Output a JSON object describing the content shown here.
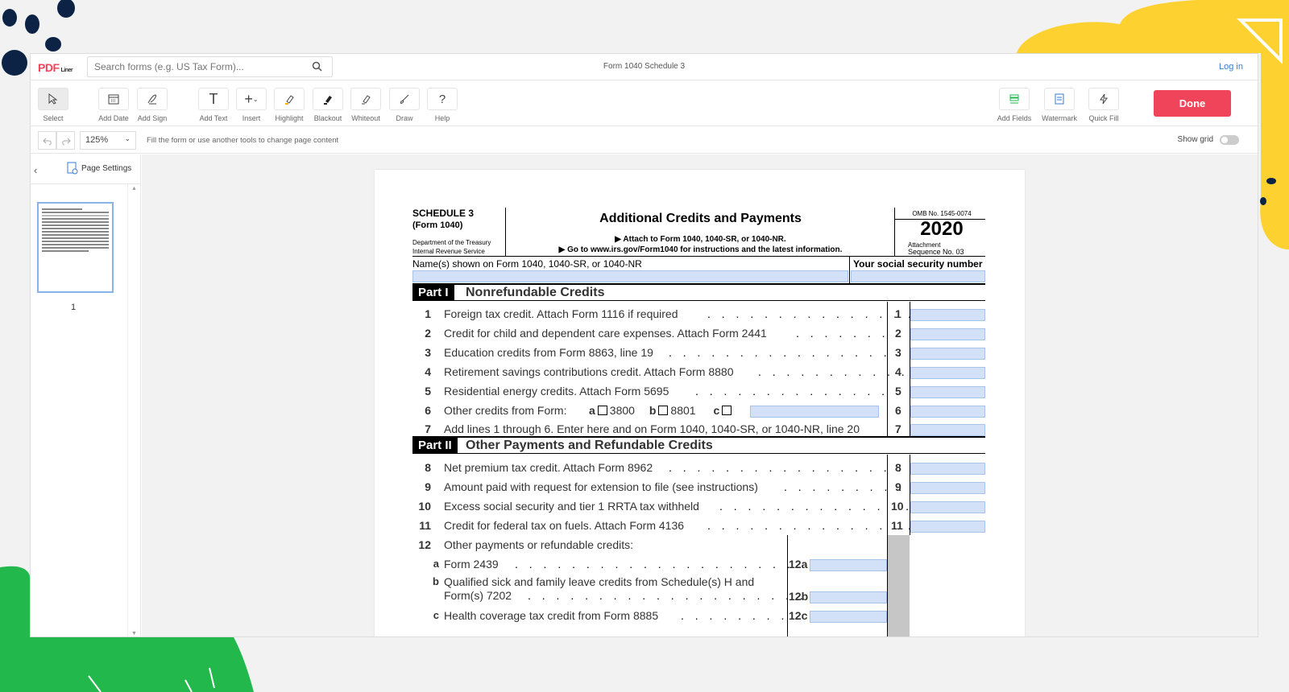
{
  "app": {
    "logo": "PDF",
    "logo_sub": "Liner",
    "search_placeholder": "Search forms (e.g. US Tax Form)...",
    "doc_title": "Form 1040 Schedule 3",
    "login": "Log in"
  },
  "toolbar": {
    "tools": [
      {
        "label": "Select",
        "icon": "cursor-icon"
      },
      {
        "label": "Add Date",
        "icon": "calendar-icon"
      },
      {
        "label": "Add Sign",
        "icon": "pen-sign-icon"
      },
      {
        "label": "Add Text",
        "icon": "text-icon"
      },
      {
        "label": "Insert",
        "icon": "plus-icon"
      },
      {
        "label": "Highlight",
        "icon": "highlighter-icon"
      },
      {
        "label": "Blackout",
        "icon": "blackout-icon"
      },
      {
        "label": "Whiteout",
        "icon": "whiteout-icon"
      },
      {
        "label": "Draw",
        "icon": "brush-icon"
      },
      {
        "label": "Help",
        "icon": "question-icon"
      },
      {
        "label": "Add Fields",
        "icon": "fields-icon"
      },
      {
        "label": "Watermark",
        "icon": "watermark-icon"
      },
      {
        "label": "Quick Fill",
        "icon": "lightning-icon"
      }
    ],
    "done_label": "Done"
  },
  "subbar": {
    "zoom": "125%",
    "hint": "Fill the form or use another tools to change page content",
    "show_grid": "Show grid"
  },
  "sidebar": {
    "page_settings": "Page Settings",
    "page_number": "1"
  },
  "form": {
    "schedule": "SCHEDULE 3",
    "form_ref": "(Form 1040)",
    "dept1": "Department of the Treasury",
    "dept2": "Internal Revenue Service",
    "title": "Additional Credits and Payments",
    "attach": "▶ Attach to Form 1040, 1040-SR, or 1040-NR.",
    "goto": "▶ Go to www.irs.gov/Form1040 for instructions and the latest information.",
    "omb": "OMB No. 1545-0074",
    "year": "2020",
    "attachment": "Attachment",
    "sequence": "Sequence No. 03",
    "name_label": "Name(s) shown on Form 1040, 1040-SR, or 1040-NR",
    "ssn_label": "Your social security number",
    "part1_label": "Part I",
    "part1_title": "Nonrefundable Credits",
    "part2_label": "Part II",
    "part2_title": "Other Payments and Refundable Credits",
    "lines_p1": [
      {
        "num": "1",
        "text": "Foreign tax credit. Attach Form 1116 if required",
        "box": "1"
      },
      {
        "num": "2",
        "text": "Credit for child and dependent care expenses. Attach Form 2441",
        "box": "2"
      },
      {
        "num": "3",
        "text": "Education credits from Form 8863, line 19",
        "box": "3"
      },
      {
        "num": "4",
        "text": "Retirement savings contributions credit. Attach Form 8880",
        "box": "4"
      },
      {
        "num": "5",
        "text": "Residential energy credits. Attach Form 5695",
        "box": "5"
      },
      {
        "num": "6",
        "text": "Other credits from Form:",
        "box": "6"
      },
      {
        "num": "7",
        "text": "Add lines 1 through 6. Enter here and on Form 1040, 1040-SR, or 1040-NR, line 20",
        "box": "7"
      }
    ],
    "line6_options": {
      "a": "a",
      "a_val": "3800",
      "b": "b",
      "b_val": "8801",
      "c": "c"
    },
    "lines_p2": [
      {
        "num": "8",
        "text": "Net premium tax credit. Attach Form 8962",
        "box": "8"
      },
      {
        "num": "9",
        "text": "Amount paid with request for extension to file (see instructions)",
        "box": "9"
      },
      {
        "num": "10",
        "text": "Excess social security and tier 1 RRTA tax withheld",
        "box": "10"
      },
      {
        "num": "11",
        "text": "Credit for federal tax on fuels. Attach Form 4136",
        "box": "11"
      }
    ],
    "line12": "Other payments or refundable credits:",
    "line12_num": "12",
    "sub12": [
      {
        "letter": "a",
        "text": "Form 2439",
        "box": "12a"
      },
      {
        "letter": "b",
        "text": "Qualified sick and family leave credits from Schedule(s) H and",
        "text2": "Form(s) 7202",
        "box": "12b"
      },
      {
        "letter": "c",
        "text": "Health coverage tax credit from Form 8885",
        "box": "12c"
      }
    ]
  },
  "colors": {
    "brand": "#f0445a",
    "field": "#d2e1f7",
    "accent_green": "#22b84c",
    "accent_yellow": "#fdd12f",
    "navy": "#0d2345"
  }
}
